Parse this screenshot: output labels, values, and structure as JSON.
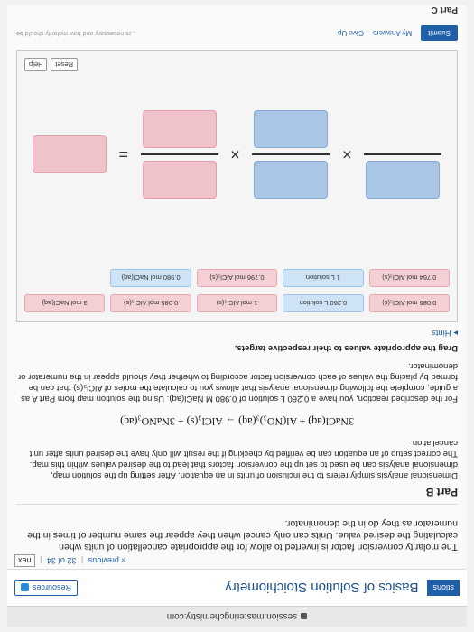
{
  "browser": {
    "url": "session.masteringchemistry.com"
  },
  "header": {
    "tab": "stions",
    "title": "Basics of Solution Stoichiometry",
    "resources": "Resources"
  },
  "nav": {
    "previous": "« previous",
    "position": "32 of 34",
    "next": "nex"
  },
  "intro": "The molarity conversion factor is inverted to allow for the appropriate cancellation of units when calculating the desired value. Units can only cancel when they appear the same number of times in the numerator as they do in the denominator.",
  "part_b": {
    "label": "Part B",
    "para1": "Dimensional analysis simply refers to the inclusion of units in an equation. After setting up the solution map, dimensional analysis can be used to set up the conversion factors that lead to the desired values within this map. The correct setup of an equation can be verified by checking if the result will only have the desired units after unit cancellation.",
    "equation": "3NaCl(aq) + Al(NO₃)₃(aq) → AlCl₃(s) + 3NaNO₃(aq)",
    "para2": "For the described reaction, you have a 0.260 L solution of 0.980 M NaCl(aq). Using the solution map from Part A as a guide, complete the following dimensional analysis that allows you to calculate the moles of AlCl₃(s) that can be formed by placing the values of each conversion factor according to whether they should appear in the numerator or denominator.",
    "drag_label": "Drag the appropriate values to their respective targets.",
    "hints": "▸ Hints"
  },
  "tiles": [
    {
      "text": "0.085 mol AlCl₃(s)",
      "color": "pink"
    },
    {
      "text": "0.260 L solution",
      "color": "blue"
    },
    {
      "text": "1 mol AlCl₃(s)",
      "color": "pink"
    },
    {
      "text": "0.085 mol AlCl₃(s)",
      "color": "pink"
    },
    {
      "text": "3 mol NaCl(aq)",
      "color": "pink"
    },
    {
      "text": "0.764 mol AlCl₃(s)",
      "color": "pink"
    },
    {
      "text": "1 L solution",
      "color": "blue"
    },
    {
      "text": "0.796 mol AlCl₃(s)",
      "color": "pink"
    },
    {
      "text": "0.980 mol NaCl(aq)",
      "color": "blue"
    }
  ],
  "operators": {
    "times1": "×",
    "times2": "×",
    "equals": "="
  },
  "buttons": {
    "reset": "Reset",
    "help": "Help",
    "submit": "Submit",
    "my_answers": "My Answers",
    "give_up": "Give Up"
  },
  "footer_note": "...rs necessary and how molarity should be",
  "part_c": "Part C"
}
